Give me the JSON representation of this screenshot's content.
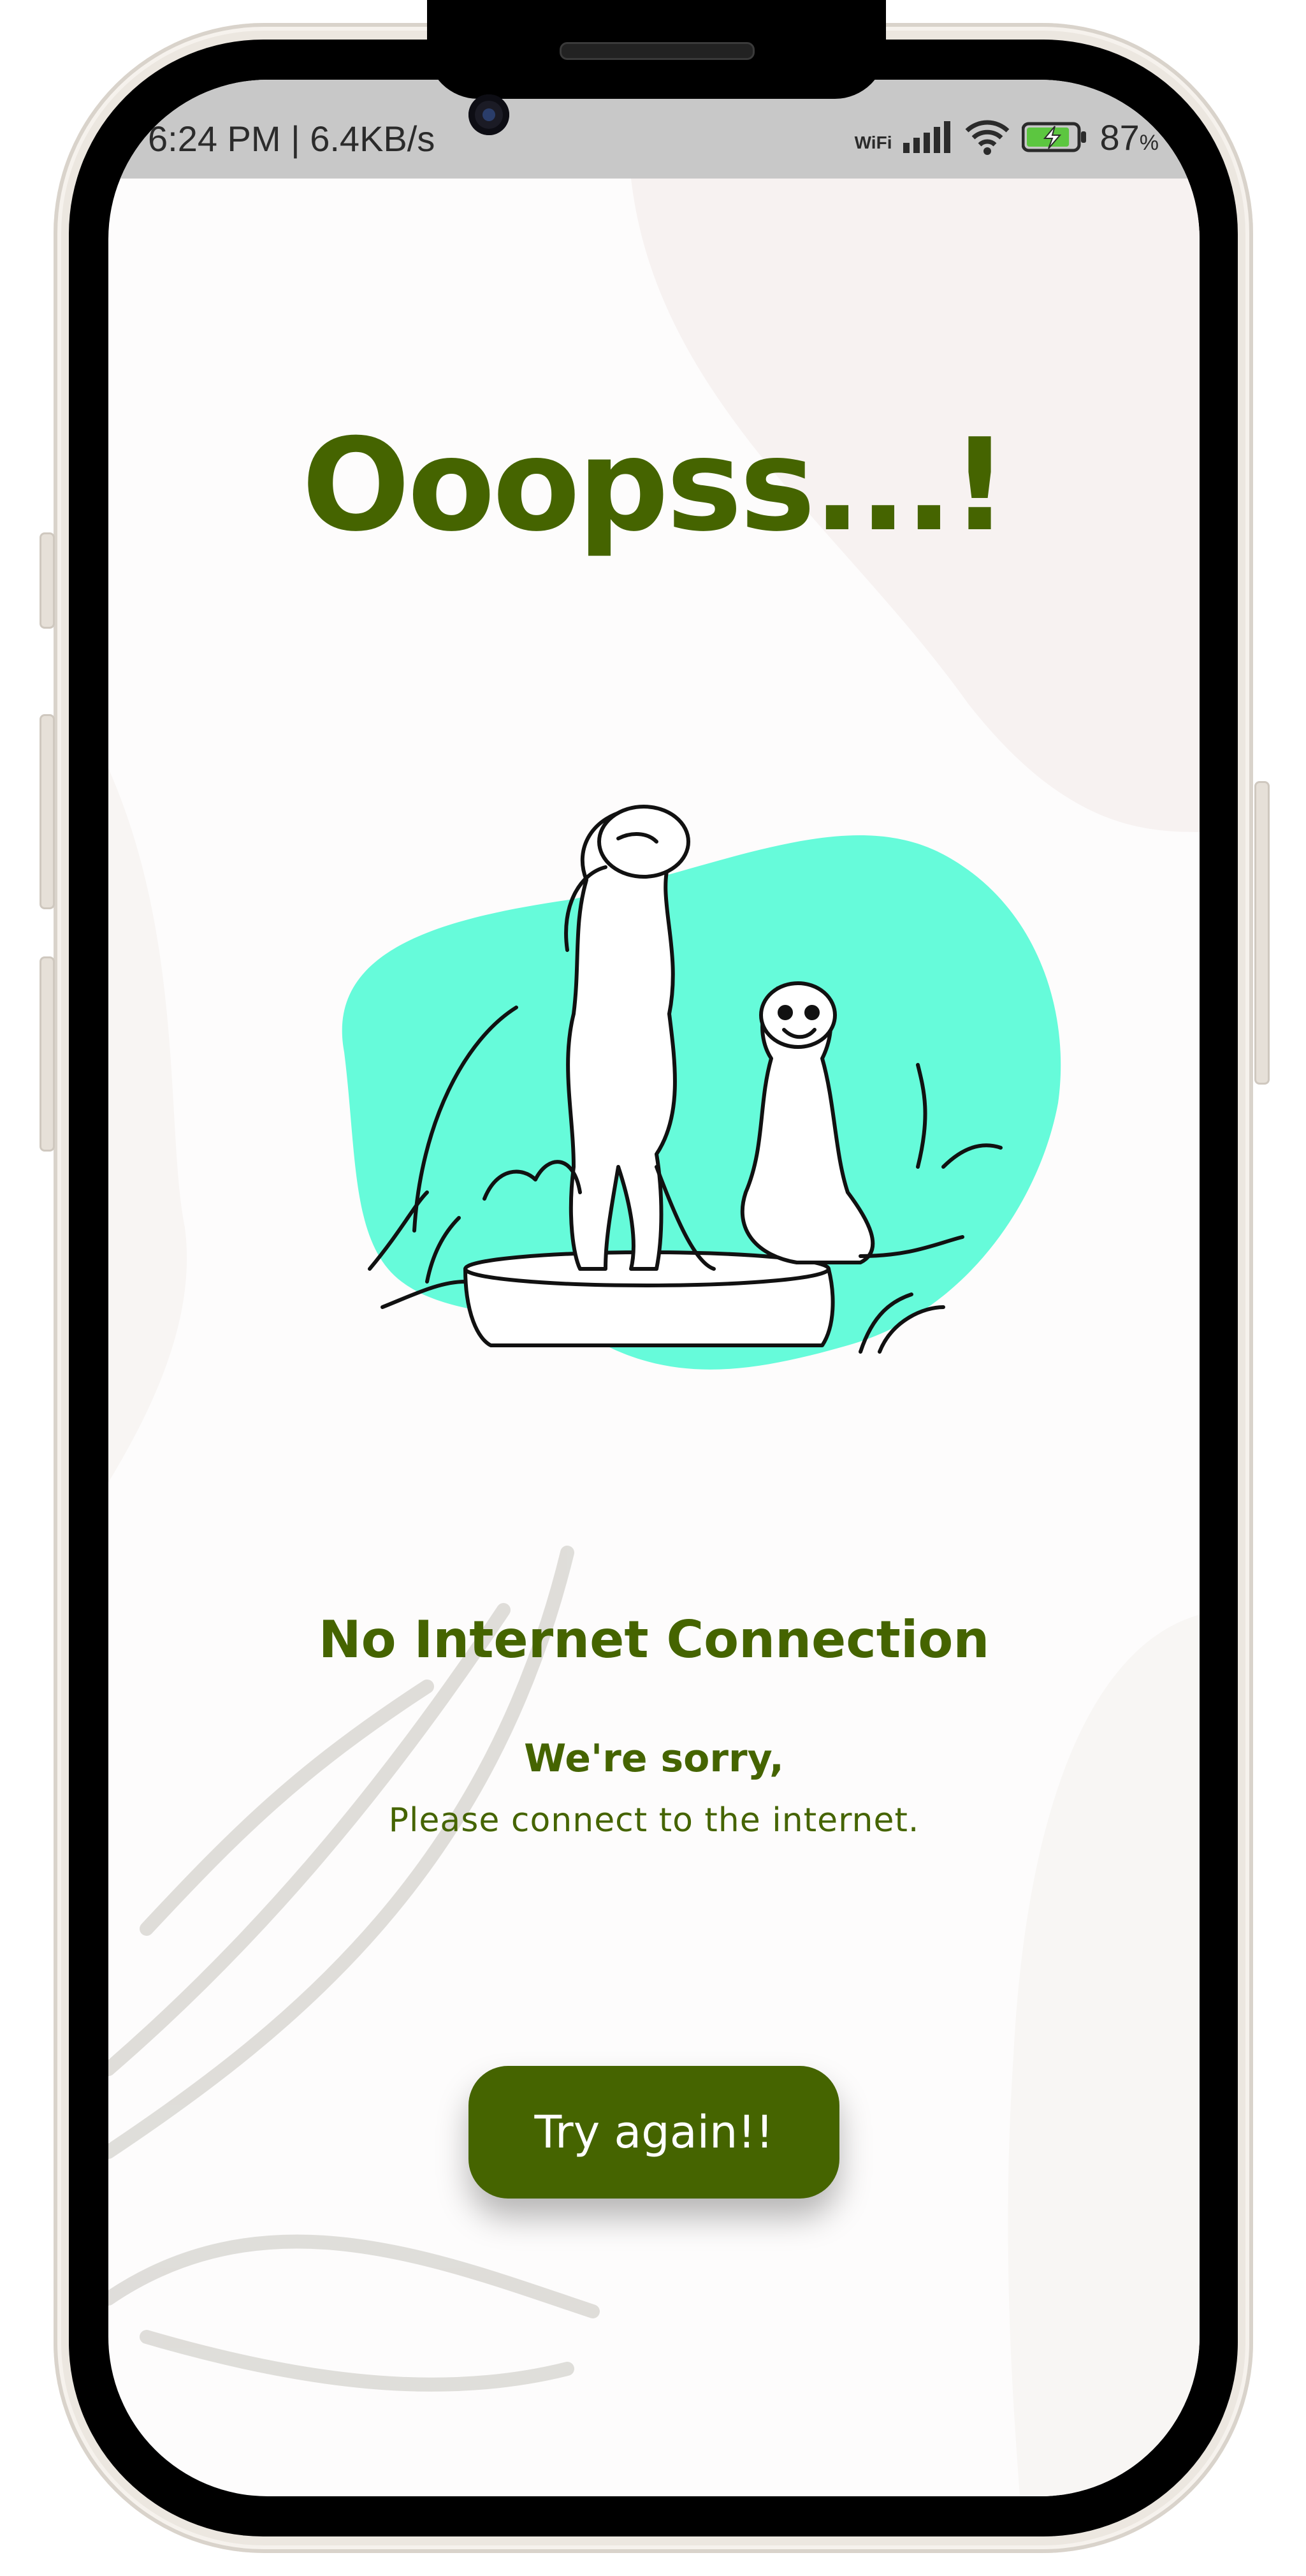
{
  "status_bar": {
    "time_speed": "6:24 PM | 6.4KB/s",
    "network_type": "WiFi",
    "battery_percent": "87",
    "battery_unit": "%",
    "battery_level": 0.87
  },
  "page": {
    "headline": "Ooopss...!",
    "subtitle": "No Internet Connection",
    "apology": "We're sorry,",
    "hint": "Please connect to the internet.",
    "retry_button": "Try again!!"
  },
  "colors": {
    "brand_green": "#456400",
    "illustration_blob": "#66fbda",
    "background": "#fdfcfc"
  },
  "icons": [
    "wifi-icon",
    "signal-icon",
    "battery-charging-icon",
    "meerkat-illustration"
  ]
}
